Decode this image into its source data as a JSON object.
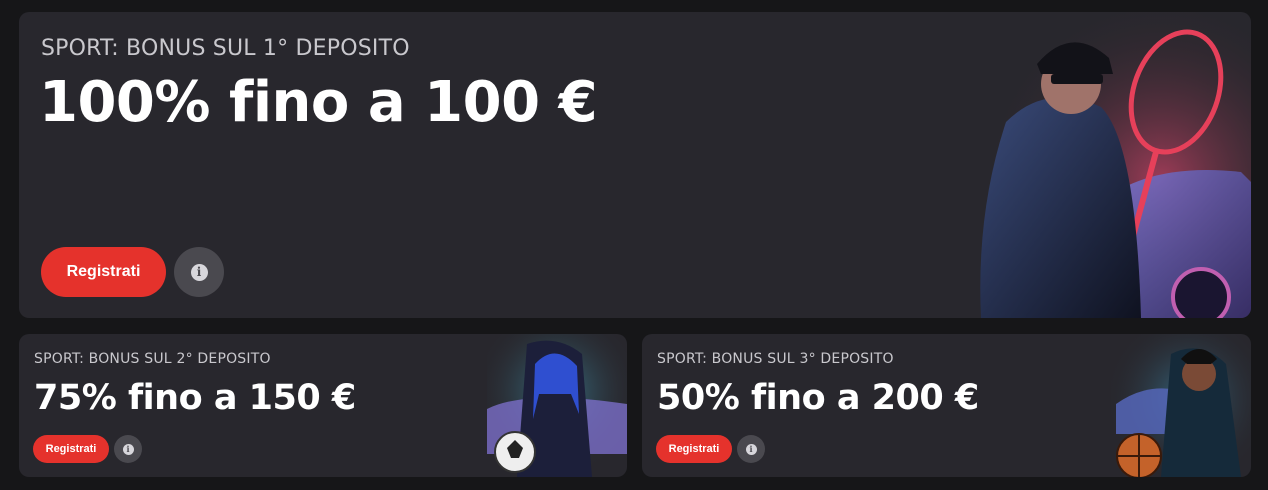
{
  "main": {
    "eyebrow": "SPORT: BONUS SUL 1° DEPOSITO",
    "headline": "100% fino a 100 €",
    "register_label": "Registrati",
    "info_icon": "info-icon",
    "info_glyph": "i"
  },
  "second": {
    "eyebrow": "SPORT: BONUS SUL 2° DEPOSITO",
    "headline": "75% fino a 150 €",
    "register_label": "Registrati",
    "info_icon": "info-icon",
    "info_glyph": "i"
  },
  "third": {
    "eyebrow": "SPORT: BONUS SUL 3° DEPOSITO",
    "headline": "50% fino a 200 €",
    "register_label": "Registrati",
    "info_icon": "info-icon",
    "info_glyph": "i"
  },
  "colors": {
    "page_bg": "#161618",
    "card_bg": "#28272d",
    "accent_red": "#e5322c",
    "info_button": "#4a494f"
  }
}
